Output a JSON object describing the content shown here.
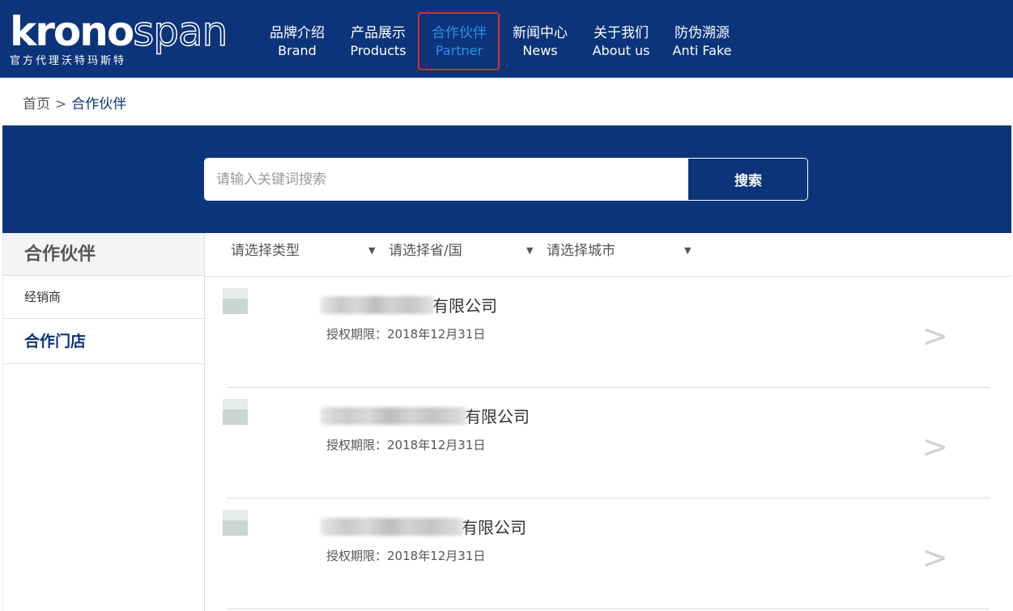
{
  "header": {
    "logo": {
      "main_bold": "krono",
      "main_outline": "span",
      "subtitle": "官方代理沃特玛斯特"
    },
    "nav": [
      {
        "cn": "品牌介绍",
        "en": "Brand"
      },
      {
        "cn": "产品展示",
        "en": "Products"
      },
      {
        "cn": "合作伙伴",
        "en": "Partner",
        "active": true
      },
      {
        "cn": "新闻中心",
        "en": "News"
      },
      {
        "cn": "关于我们",
        "en": "About us"
      },
      {
        "cn": "防伪溯源",
        "en": "Anti Fake"
      }
    ]
  },
  "breadcrumb": {
    "home": "首页",
    "separator": ">",
    "current": "合作伙伴"
  },
  "search": {
    "placeholder": "请输入关键词搜索",
    "button_label": "搜索"
  },
  "sidebar": {
    "title": "合作伙伴",
    "items": [
      {
        "label": "经销商"
      },
      {
        "label": "合作门店",
        "active": true
      }
    ]
  },
  "filters": [
    {
      "label": "请选择类型"
    },
    {
      "label": "请选择省/国"
    },
    {
      "label": "请选择城市"
    }
  ],
  "partners": [
    {
      "name_suffix": "有限公司",
      "term_label": "授权期限：",
      "term_value": "2018年12月31日"
    },
    {
      "name_suffix": "有限公司",
      "term_label": "授权期限：",
      "term_value": "2018年12月31日"
    },
    {
      "name_suffix": "有限公司",
      "term_label": "授权期限：",
      "term_value": "2018年12月31日"
    }
  ],
  "icons": {
    "filter_caret": "caret-down-icon",
    "row_arrow": "chevron-right-icon"
  },
  "colors": {
    "brand_navy": "#0b347a",
    "active_nav": "#2f8fe8",
    "highlight_border": "#e52a2a"
  }
}
